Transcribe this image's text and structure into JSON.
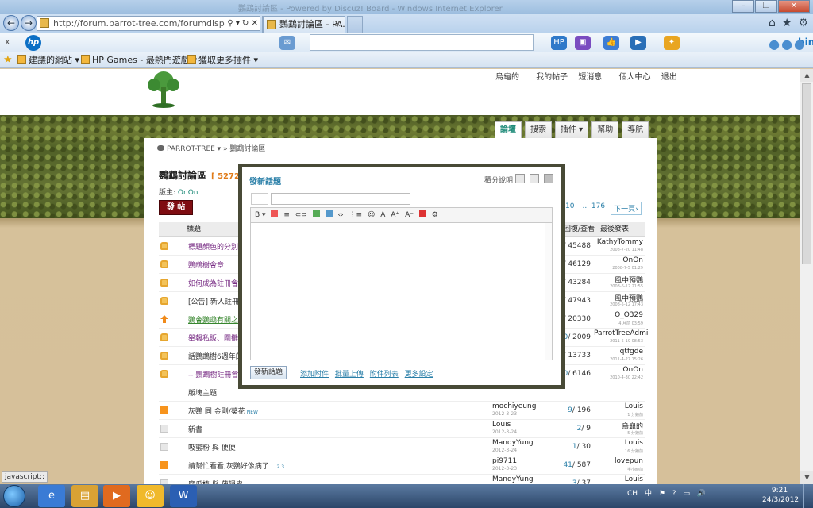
{
  "browser": {
    "window_title": "鸚鵡討論區 - Powered by Discuz! Board - Windows Internet Explorer",
    "address": "http://forum.parrot-tree.com/forumdisplay.php",
    "tabs": [
      {
        "label": "http://forum.parrot-tree.com/forumdisplay.ph"
      },
      {
        "label": "鸚鵡討論區 - PA..."
      }
    ],
    "favbar": [
      "建議的網站 ▾",
      "HP Games - 最熱門遊戲 ▾",
      "獲取更多插件 ▾"
    ],
    "hp_close": "x",
    "hp_logo": "hp",
    "bing_label": "bing"
  },
  "site": {
    "user_menu": {
      "username": "烏龜的",
      "links": [
        "我的帖子",
        "短消息",
        "個人中心",
        "退出"
      ]
    },
    "nav": [
      "論壇",
      "搜索",
      "插件 ▾",
      "幫助",
      "導航"
    ],
    "breadcrumb": "PARROT-TREE ▾  » 鸚鵡討論區",
    "forum_title": "鸚鵡討論區",
    "forum_count": "[ 5272",
    "moderator_label": "版主:",
    "moderator": "OnOn",
    "post_button": "發 帖",
    "pager": [
      "10",
      "... 176",
      "下一頁›"
    ],
    "columns": {
      "title": "標題",
      "replies": "回復/查看",
      "last": "最後發表"
    }
  },
  "threads": [
    {
      "icon": "lock",
      "title": "標題顏色的分別",
      "style": "purple",
      "replies": "",
      "views": "45488",
      "last_user": "KathyTommy",
      "last_date": "2008-7-20 11:48"
    },
    {
      "icon": "lock",
      "title": "鸚鵡樹會章",
      "style": "purple",
      "replies": "",
      "views": "46129",
      "last_user": "OnOn",
      "last_date": "2008-7-5 01:29"
    },
    {
      "icon": "lock",
      "title": "如何成為註冊會員",
      "style": "purple",
      "replies": "",
      "views": "43284",
      "last_user": "風中預鸚",
      "last_date": "2008-6-12 21:55"
    },
    {
      "icon": "lock",
      "title": "[公告] 新人註冊,",
      "style": "plain",
      "replies": "",
      "views": "47943",
      "last_user": "風中預鸚",
      "last_date": "2008-5-12 17:43"
    },
    {
      "icon": "up",
      "title": "鸚會鸚鵡有關之書",
      "style": "green",
      "replies": "",
      "views": "20330",
      "last_user": "O_O329",
      "last_date": "4 月前 03:59"
    },
    {
      "icon": "lock",
      "title": "舉報私販、圍攤等",
      "style": "purple",
      "replies": "0",
      "views": "2009",
      "last_user": "ParrotTreeAdmi",
      "last_date": "2011-5-19 08:53"
    },
    {
      "icon": "lock",
      "title": "話鸚鵡樹6週年的",
      "style": "plain",
      "replies": "",
      "views": "13733",
      "last_user": "qtfgde",
      "last_date": "2011-4-27 15:26"
    },
    {
      "icon": "lock",
      "title": "-- 鸚鵡樹註冊會員",
      "style": "purple",
      "replies": "0",
      "views": "6146",
      "last_user": "OnOn",
      "last_date": "2010-4-30 22:42"
    }
  ],
  "section_label": "版塊主題",
  "normal_threads": [
    {
      "icon": "hot",
      "title": "灰鸚 同 金剛/葵花",
      "badge": "NEW",
      "author": "mochiyeung",
      "date": "2012-3-23",
      "replies": "9",
      "views": "196",
      "last_user": "Louis",
      "last_date": "1 分鐘前"
    },
    {
      "icon": "doc",
      "title": "新書",
      "badge": "",
      "author": "Louis",
      "date": "2012-3-24",
      "replies": "2",
      "views": "9",
      "last_user": "烏龜的",
      "last_date": "5 分鐘前"
    },
    {
      "icon": "doc",
      "title": "吸蜜粉  與  便便",
      "badge": "",
      "author": "MandyYung",
      "date": "2012-3-24",
      "replies": "1",
      "views": "30",
      "last_user": "Louis",
      "last_date": "16 分鐘前"
    },
    {
      "icon": "hot",
      "title": "請幫忙看看,灰鸚好像病了",
      "badge": "... 2 3",
      "author": "pi9711",
      "date": "2012-3-23",
      "replies": "41",
      "views": "587",
      "last_user": "lovepun",
      "last_date": "半小時前"
    },
    {
      "icon": "doc",
      "title": "磨爪棒  與  蒲翅皮",
      "badge": "",
      "author": "MandyYung",
      "date": "",
      "replies": "3",
      "views": "37",
      "last_user": "Louis",
      "last_date": "1 小時前"
    }
  ],
  "dialog": {
    "title": "發新話題",
    "help": "積分說明",
    "toolbar": [
      "B ▾",
      "≡",
      "⊂⊃",
      "☺",
      "‹›",
      "⋮≡",
      "A",
      "A⁺",
      "A⁻",
      "⚙"
    ],
    "submit": "發新話題",
    "links": [
      "添加附件",
      "批量上傳",
      "附件列表",
      "更多設定"
    ]
  },
  "status": "javascript:;",
  "taskbar": {
    "tray": [
      "CH",
      "中",
      "⚑",
      "?",
      "▭",
      "🔊"
    ],
    "time": "9:21",
    "date": "24/3/2012"
  }
}
